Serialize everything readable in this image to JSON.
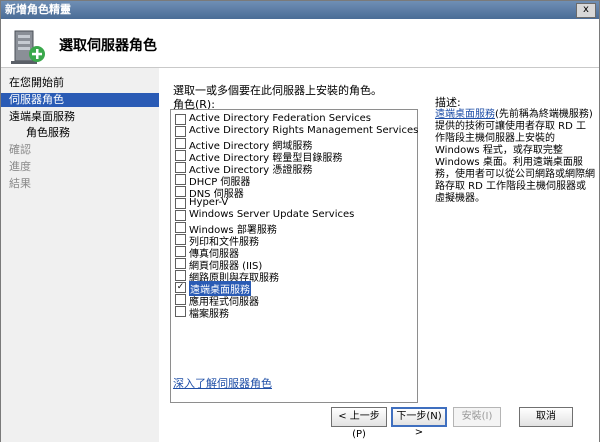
{
  "window": {
    "title": "新增角色精靈",
    "close": "x"
  },
  "header": {
    "title": "選取伺服器角色"
  },
  "nav": {
    "items": [
      {
        "label": "在您開始前",
        "state": "normal",
        "level": 0
      },
      {
        "label": "伺服器角色",
        "state": "active",
        "level": 0
      },
      {
        "label": "遠端桌面服務",
        "state": "normal",
        "level": 1
      },
      {
        "label": "角色服務",
        "state": "normal",
        "level": 2
      },
      {
        "label": "確認",
        "state": "disabled",
        "level": 0
      },
      {
        "label": "進度",
        "state": "disabled",
        "level": 0
      },
      {
        "label": "結果",
        "state": "disabled",
        "level": 0
      }
    ]
  },
  "main": {
    "instruction": "選取一或多個要在此伺服器上安裝的角色。",
    "roles_label": "角色(R):",
    "roles": [
      {
        "label": "Active Directory Federation Services",
        "checked": false
      },
      {
        "label": "Active Directory Rights Management Services",
        "checked": false
      },
      {
        "label": "Active Directory 網域服務",
        "checked": false
      },
      {
        "label": "Active Directory 輕量型目錄服務",
        "checked": false
      },
      {
        "label": "Active Directory 憑證服務",
        "checked": false
      },
      {
        "label": "DHCP 伺服器",
        "checked": false
      },
      {
        "label": "DNS 伺服器",
        "checked": false
      },
      {
        "label": "Hyper-V",
        "checked": false
      },
      {
        "label": "Windows Server Update Services",
        "checked": false
      },
      {
        "label": "Windows 部署服務",
        "checked": false
      },
      {
        "label": "列印和文件服務",
        "checked": false
      },
      {
        "label": "傳真伺服器",
        "checked": false
      },
      {
        "label": "網頁伺服器 (IIS)",
        "checked": false
      },
      {
        "label": "網路原則與存取服務",
        "checked": false
      },
      {
        "label": "遠端桌面服務",
        "checked": true,
        "selected": true
      },
      {
        "label": "應用程式伺服器",
        "checked": false
      },
      {
        "label": "檔案服務",
        "checked": false
      }
    ],
    "learn_more_link": "深入了解伺服器角色",
    "description": {
      "heading": "描述:",
      "link": "遠端桌面服務",
      "text": "(先前稱為終端機服務) 提供的技術可讓使用者存取 RD 工作階段主機伺服器上安裝的 Windows 程式，或存取完整 Windows 桌面。利用遠端桌面服務，使用者可以從公司網路或網際網路存取 RD 工作階段主機伺服器或虛擬機器。"
    }
  },
  "buttons": {
    "back": "< 上一步(P)",
    "next": "下一步(N) >",
    "install": "安裝(I)",
    "cancel": "取消"
  },
  "colors": {
    "accent": "#2a5bb5",
    "link": "#1f4fa7",
    "title_bar": "#4a6c96"
  },
  "icons": {
    "header": "server-add-icon"
  }
}
